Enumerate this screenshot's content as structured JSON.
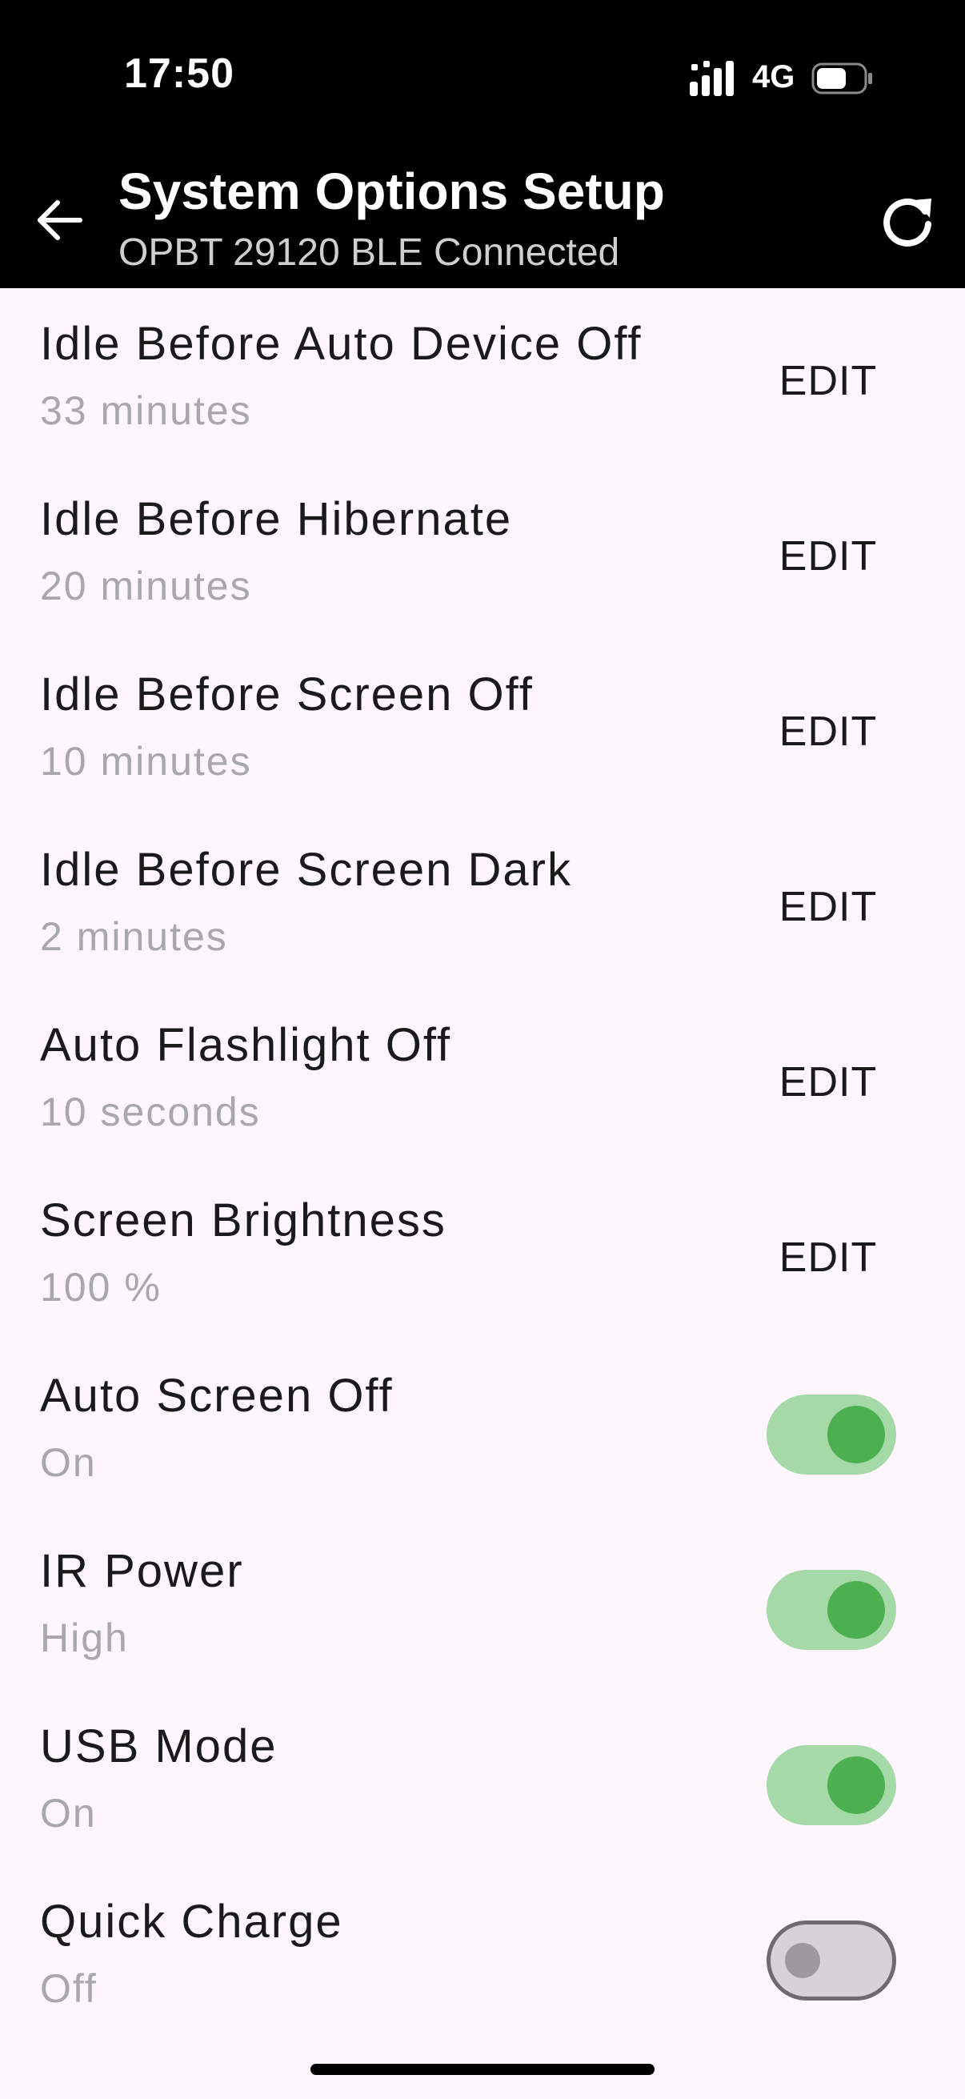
{
  "status_bar": {
    "time": "17:50",
    "network": "4G"
  },
  "header": {
    "title": "System Options Setup",
    "subtitle": "OPBT 29120 BLE Connected",
    "back_icon": "arrow-left-icon",
    "refresh_icon": "refresh-icon"
  },
  "settings": [
    {
      "label": "Idle Before Auto Device Off",
      "value": "33 minutes",
      "action": "EDIT"
    },
    {
      "label": "Idle Before Hibernate",
      "value": "20 minutes",
      "action": "EDIT"
    },
    {
      "label": "Idle Before Screen Off",
      "value": "10 minutes",
      "action": "EDIT"
    },
    {
      "label": "Idle Before Screen Dark",
      "value": "2 minutes",
      "action": "EDIT"
    },
    {
      "label": "Auto Flashlight Off",
      "value": "10 seconds",
      "action": "EDIT"
    },
    {
      "label": "Screen Brightness",
      "value": "100 %",
      "action": "EDIT"
    },
    {
      "label": "Auto Screen Off",
      "value": "On",
      "toggle": true
    },
    {
      "label": "IR Power",
      "value": "High",
      "toggle": true
    },
    {
      "label": "USB Mode",
      "value": "On",
      "toggle": true
    },
    {
      "label": "Quick Charge",
      "value": "Off",
      "toggle": false
    }
  ],
  "colors": {
    "app_bar": "#000000",
    "background": "#fdf6fd",
    "toggle_on_track": "#a6d9a8",
    "toggle_on_knob": "#4caf50",
    "toggle_off_track": "#d7d2d7",
    "secondary_text": "#a8a8a8"
  }
}
